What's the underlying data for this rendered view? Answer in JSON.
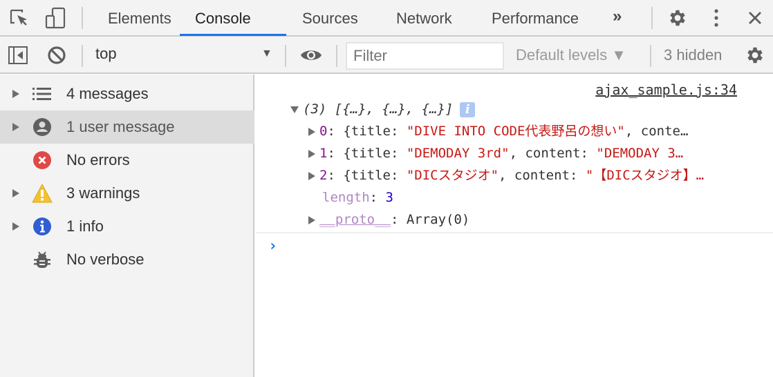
{
  "tabs": [
    {
      "label": "Elements",
      "active": false
    },
    {
      "label": "Console",
      "active": true
    },
    {
      "label": "Sources",
      "active": false
    },
    {
      "label": "Network",
      "active": false
    },
    {
      "label": "Performance",
      "active": false
    }
  ],
  "more_tabs_glyph": "»",
  "accent_color": "#1a73e8",
  "toolbar": {
    "context": "top",
    "filter_placeholder": "Filter",
    "filter_value": "",
    "levels": "Default levels ▼",
    "hidden": "3 hidden"
  },
  "sidebar": {
    "items": [
      {
        "label": "4 messages",
        "icon": "list-icon",
        "expandable": true,
        "selected": false
      },
      {
        "label": "1 user message",
        "icon": "user-icon",
        "expandable": true,
        "selected": true
      },
      {
        "label": "No errors",
        "icon": "error-icon",
        "expandable": false,
        "selected": false
      },
      {
        "label": "3 warnings",
        "icon": "warning-icon",
        "expandable": true,
        "selected": false
      },
      {
        "label": "1 info",
        "icon": "info-icon",
        "expandable": true,
        "selected": false
      },
      {
        "label": "No verbose",
        "icon": "bug-icon",
        "expandable": false,
        "selected": false
      }
    ]
  },
  "console": {
    "source_link": "ajax_sample.js:34",
    "array_summary": "(3) [{…}, {…}, {…}]",
    "info_badge": "i",
    "entries": [
      {
        "index": "0",
        "prefix": ": {title: ",
        "title": "\"DIVE INTO CODE代表野呂の想い\"",
        "rest": ", conte…",
        "content": ""
      },
      {
        "index": "1",
        "prefix": ": {title: ",
        "title": "\"DEMODAY 3rd\"",
        "rest": ", content: ",
        "content": "\"DEMODAY 3…"
      },
      {
        "index": "2",
        "prefix": ": {title: ",
        "title": "\"DICスタジオ\"",
        "rest": ", content: ",
        "content": "\"【DICスタジオ】…"
      }
    ],
    "length_key": "length",
    "length_value": "3",
    "proto_key": "__proto__",
    "proto_value": ": Array(0)",
    "prompt": "›"
  }
}
